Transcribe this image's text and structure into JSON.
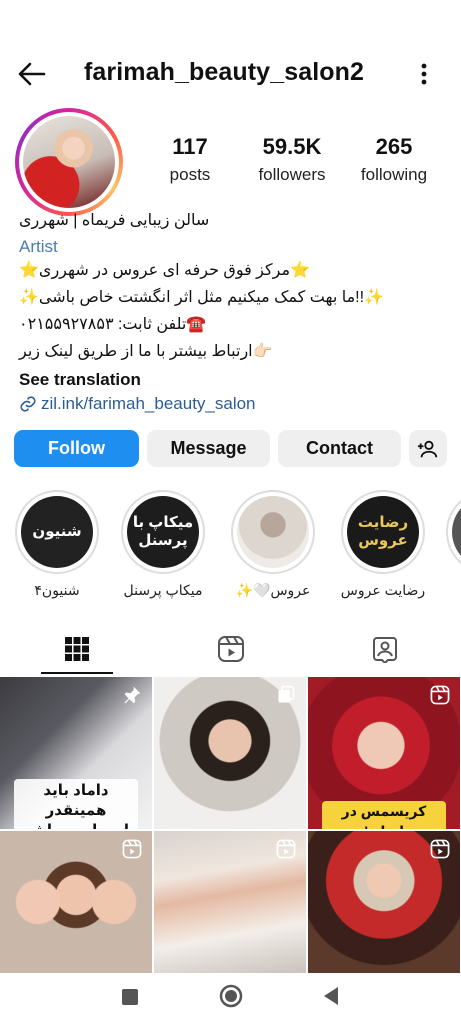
{
  "header": {
    "username": "farimah_beauty_salon2"
  },
  "stats": {
    "posts_count": "117",
    "posts_label": "posts",
    "followers_count": "59.5K",
    "followers_label": "followers",
    "following_count": "265",
    "following_label": "following"
  },
  "bio": {
    "name": "سالن زیبایی فریماه  |  شهرری",
    "category": "Artist",
    "line1": "⭐مرکز فوق حرفه ای عروس در شهرری⭐",
    "line2": "✨!!ما بهت کمک میکنیم مثل اثر انگشتت خاص باشی✨",
    "line3": "☎️تلفن ثابت: ۰۲۱۵۵۹۲۷۸۵۳",
    "line4": "👉🏻ارتباط بیشتر با ما از طریق لینک زیر",
    "see_translation": "See translation",
    "link": "zil.ink/farimah_beauty_salon"
  },
  "buttons": {
    "follow": "Follow",
    "message": "Message",
    "contact": "Contact"
  },
  "highlights": [
    {
      "caption": "شنیون۴",
      "cover_text": "شنیون"
    },
    {
      "caption": "میکاپ پرسنل",
      "cover_text": "میکاپ با پرسنل"
    },
    {
      "caption": "عروس🤍✨",
      "cover_text": ""
    },
    {
      "caption": "رضایت عروس",
      "cover_text": "رضایت عروس"
    }
  ],
  "posts": [
    {
      "overlay": "داماد باید همینقدر احساسی باشه😂"
    },
    {
      "overlay": ""
    },
    {
      "overlay": "کریسمس در ایران!"
    },
    {
      "overlay": ""
    },
    {
      "overlay": ""
    },
    {
      "overlay": ""
    }
  ],
  "colors": {
    "follow_button": "#1f8ef1",
    "link": "#2d5d96",
    "category": "#4a7bb1"
  }
}
